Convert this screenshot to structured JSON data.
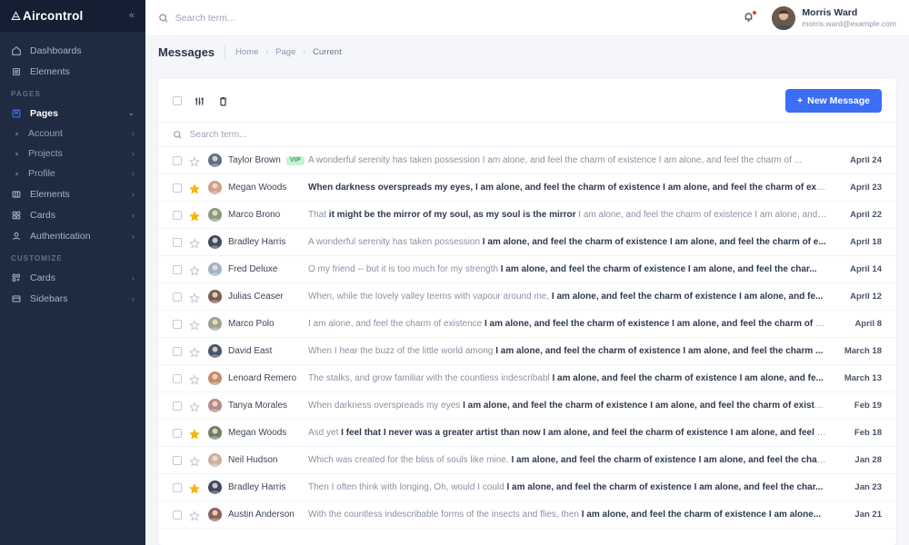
{
  "brand": {
    "name": "Aircontrol",
    "collapse_icon": "chevrons-left-icon"
  },
  "sidebar": {
    "top_items": [
      {
        "label": "Dashboards",
        "icon": "home-icon"
      },
      {
        "label": "Elements",
        "icon": "chip-icon"
      }
    ],
    "sections": [
      {
        "title": "PAGES",
        "items": [
          {
            "label": "Pages",
            "icon": "book-icon",
            "active": true,
            "chevron": "chevron-down-icon"
          },
          {
            "label": "Account",
            "sub": true,
            "chevron": "chevron-right-icon"
          },
          {
            "label": "Projects",
            "sub": true,
            "chevron": "chevron-right-icon"
          },
          {
            "label": "Profile",
            "sub": true,
            "chevron": "chevron-right-icon"
          },
          {
            "label": "Elements",
            "icon": "columns-icon",
            "chevron": "chevron-right-icon"
          },
          {
            "label": "Cards",
            "icon": "grid-icon",
            "chevron": "chevron-right-icon"
          },
          {
            "label": "Authentication",
            "icon": "user-icon",
            "chevron": "chevron-right-icon"
          }
        ]
      },
      {
        "title": "CUSTOMIZE",
        "items": [
          {
            "label": "Cards",
            "icon": "grid-plus-icon",
            "chevron": "chevron-right-icon"
          },
          {
            "label": "Sidebars",
            "icon": "sidebar-icon",
            "chevron": "chevron-right-icon"
          }
        ]
      }
    ]
  },
  "topbar": {
    "search_placeholder": "Search term...",
    "search_value": "",
    "search_icon": "search-icon",
    "bell_icon": "bell-icon",
    "has_notification": true,
    "user": {
      "name": "Morris Ward",
      "email": "morris.ward@example.com"
    }
  },
  "pagehead": {
    "title": "Messages",
    "breadcrumb": [
      {
        "label": "Home",
        "current": false
      },
      {
        "label": "Page",
        "current": false
      },
      {
        "label": "Current",
        "current": true
      }
    ],
    "separator": "›"
  },
  "toolbar": {
    "select_all_checkbox": false,
    "filter_icon": "sliders-icon",
    "delete_icon": "trash-icon",
    "new_message_label": "New Message",
    "new_message_plus": "+",
    "accent_color": "#3b6ef5"
  },
  "list_search": {
    "placeholder": "Search term...",
    "value": "",
    "icon": "search-icon"
  },
  "messages": [
    {
      "sender": "Taylor Brown",
      "vip": "VIP",
      "starred": false,
      "avatar_color": "#5c6f86",
      "text_plain": "A wonderful serenity has taken possession I am alone, and feel the charm of existence I am alone, and feel the charm of ...",
      "text_bold": "",
      "date": "April 24"
    },
    {
      "sender": "Megan Woods",
      "vip": "",
      "starred": true,
      "avatar_color": "#cf9f8e",
      "text_plain": "",
      "text_bold": "When darkness overspreads my eyes, I am alone, and feel the charm of existence I am alone, and feel the charm of exist...",
      "date": "April 23"
    },
    {
      "sender": "Marco Brono",
      "vip": "",
      "starred": true,
      "avatar_color": "#8a9a7b",
      "text_plain": "That ",
      "text_bold": "it might be the mirror of my soul, as my soul is the mirror",
      "text_tail": " I am alone, and feel the charm of existence I am alone, and ...",
      "date": "April 22"
    },
    {
      "sender": "Bradley Harris",
      "vip": "",
      "starred": false,
      "avatar_color": "#3c4a63",
      "text_plain": "A wonderful serenity has taken possession ",
      "text_bold": "I am alone, and feel the charm of existence I am alone, and feel the charm of e...",
      "date": "April 18"
    },
    {
      "sender": "Fred Deluxe",
      "vip": "",
      "starred": false,
      "avatar_color": "#9fb3c8",
      "text_plain": "O my friend -- but it is too much for my strength ",
      "text_bold": "I am alone, and feel the charm of existence I am alone, and feel the char...",
      "date": "April 14"
    },
    {
      "sender": "Julias Ceaser",
      "vip": "",
      "starred": false,
      "avatar_color": "#7a5c4e",
      "text_plain": "When, while the lovely valley teems with vapour around me, ",
      "text_bold": "I am alone, and feel the charm of existence I am alone, and fe...",
      "date": "April 12"
    },
    {
      "sender": "Marco Polo",
      "vip": "",
      "starred": false,
      "avatar_color": "#97a58e",
      "text_plain": "I am alone, and feel the charm of existence ",
      "text_bold": "I am alone, and feel the charm of existence I am alone, and feel the charm of e...",
      "date": "April 8"
    },
    {
      "sender": "David East",
      "vip": "",
      "starred": false,
      "avatar_color": "#44546b",
      "text_plain": "When I hear the buzz of the little world among ",
      "text_bold": "I am alone, and feel the charm of existence I am alone, and feel the charm ...",
      "date": "March 18"
    },
    {
      "sender": "Lenoard Remero",
      "vip": "",
      "starred": false,
      "avatar_color": "#c08b6a",
      "text_plain": "The stalks, and grow familiar with the countless indescribabl ",
      "text_bold": "I am alone, and feel the charm of existence I am alone, and fe...",
      "date": "March 13"
    },
    {
      "sender": "Tanya Morales",
      "vip": "",
      "starred": false,
      "avatar_color": "#b08a8a",
      "text_plain": "When darkness overspreads my eyes ",
      "text_bold": "I am alone, and feel the charm of existence I am alone, and feel the charm of existen...",
      "date": "Feb 19"
    },
    {
      "sender": "Megan Woods",
      "vip": "",
      "starred": true,
      "avatar_color": "#6d7f6a",
      "text_plain": "Asd yet ",
      "text_bold": "I feel that I never was a greater artist than now I am alone, and feel the charm of existence I am alone, and feel the...",
      "date": "Feb 18"
    },
    {
      "sender": "Neil Hudson",
      "vip": "",
      "starred": false,
      "avatar_color": "#c7b3a4",
      "text_plain": "Which was created for the bliss of souls like mine. ",
      "text_bold": "I am alone, and feel the charm of existence I am alone, and feel the char...",
      "date": "Jan 28"
    },
    {
      "sender": "Bradley Harris",
      "vip": "",
      "starred": true,
      "avatar_color": "#3c4a63",
      "text_plain": "Then I often think with longing, Oh, would I could ",
      "text_bold": "I am alone, and feel the charm of existence I am alone, and feel the char...",
      "date": "Jan 23"
    },
    {
      "sender": "Austin Anderson",
      "vip": "",
      "starred": false,
      "avatar_color": "#8d5f5f",
      "text_plain": "With the countless indescribable forms of the insects and flies, then ",
      "text_bold": "I am alone, and feel the charm of existence I am alone...",
      "date": "Jan 21"
    }
  ]
}
